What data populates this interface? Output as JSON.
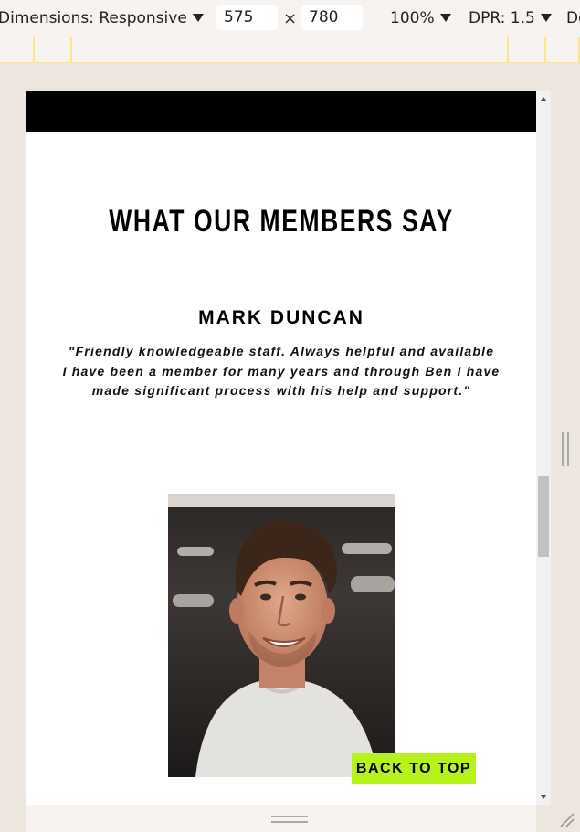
{
  "devtools": {
    "dimensions_label": "Dimensions: Responsive",
    "width_value": "575",
    "height_value": "780",
    "times_symbol": "×",
    "zoom_label": "100%",
    "dpr_label": "DPR: 1.5",
    "truncated_label": "De"
  },
  "page": {
    "heading": "WHAT OUR MEMBERS SAY",
    "member_name": "MARK DUNCAN",
    "quote_lines": [
      "\"Friendly knowledgeable staff. Always helpful and available",
      "I have been a member for many years and through Ben I have",
      "made significant process with his help and support.\""
    ],
    "back_to_top": "BACK TO TOP",
    "accent_color": "#b6f21c"
  },
  "icons": {
    "caret": "chevron-down-icon",
    "scroll_up": "scroll-up-arrow-icon",
    "scroll_down": "scroll-down-arrow-icon",
    "resize": "resize-handle-icon"
  }
}
